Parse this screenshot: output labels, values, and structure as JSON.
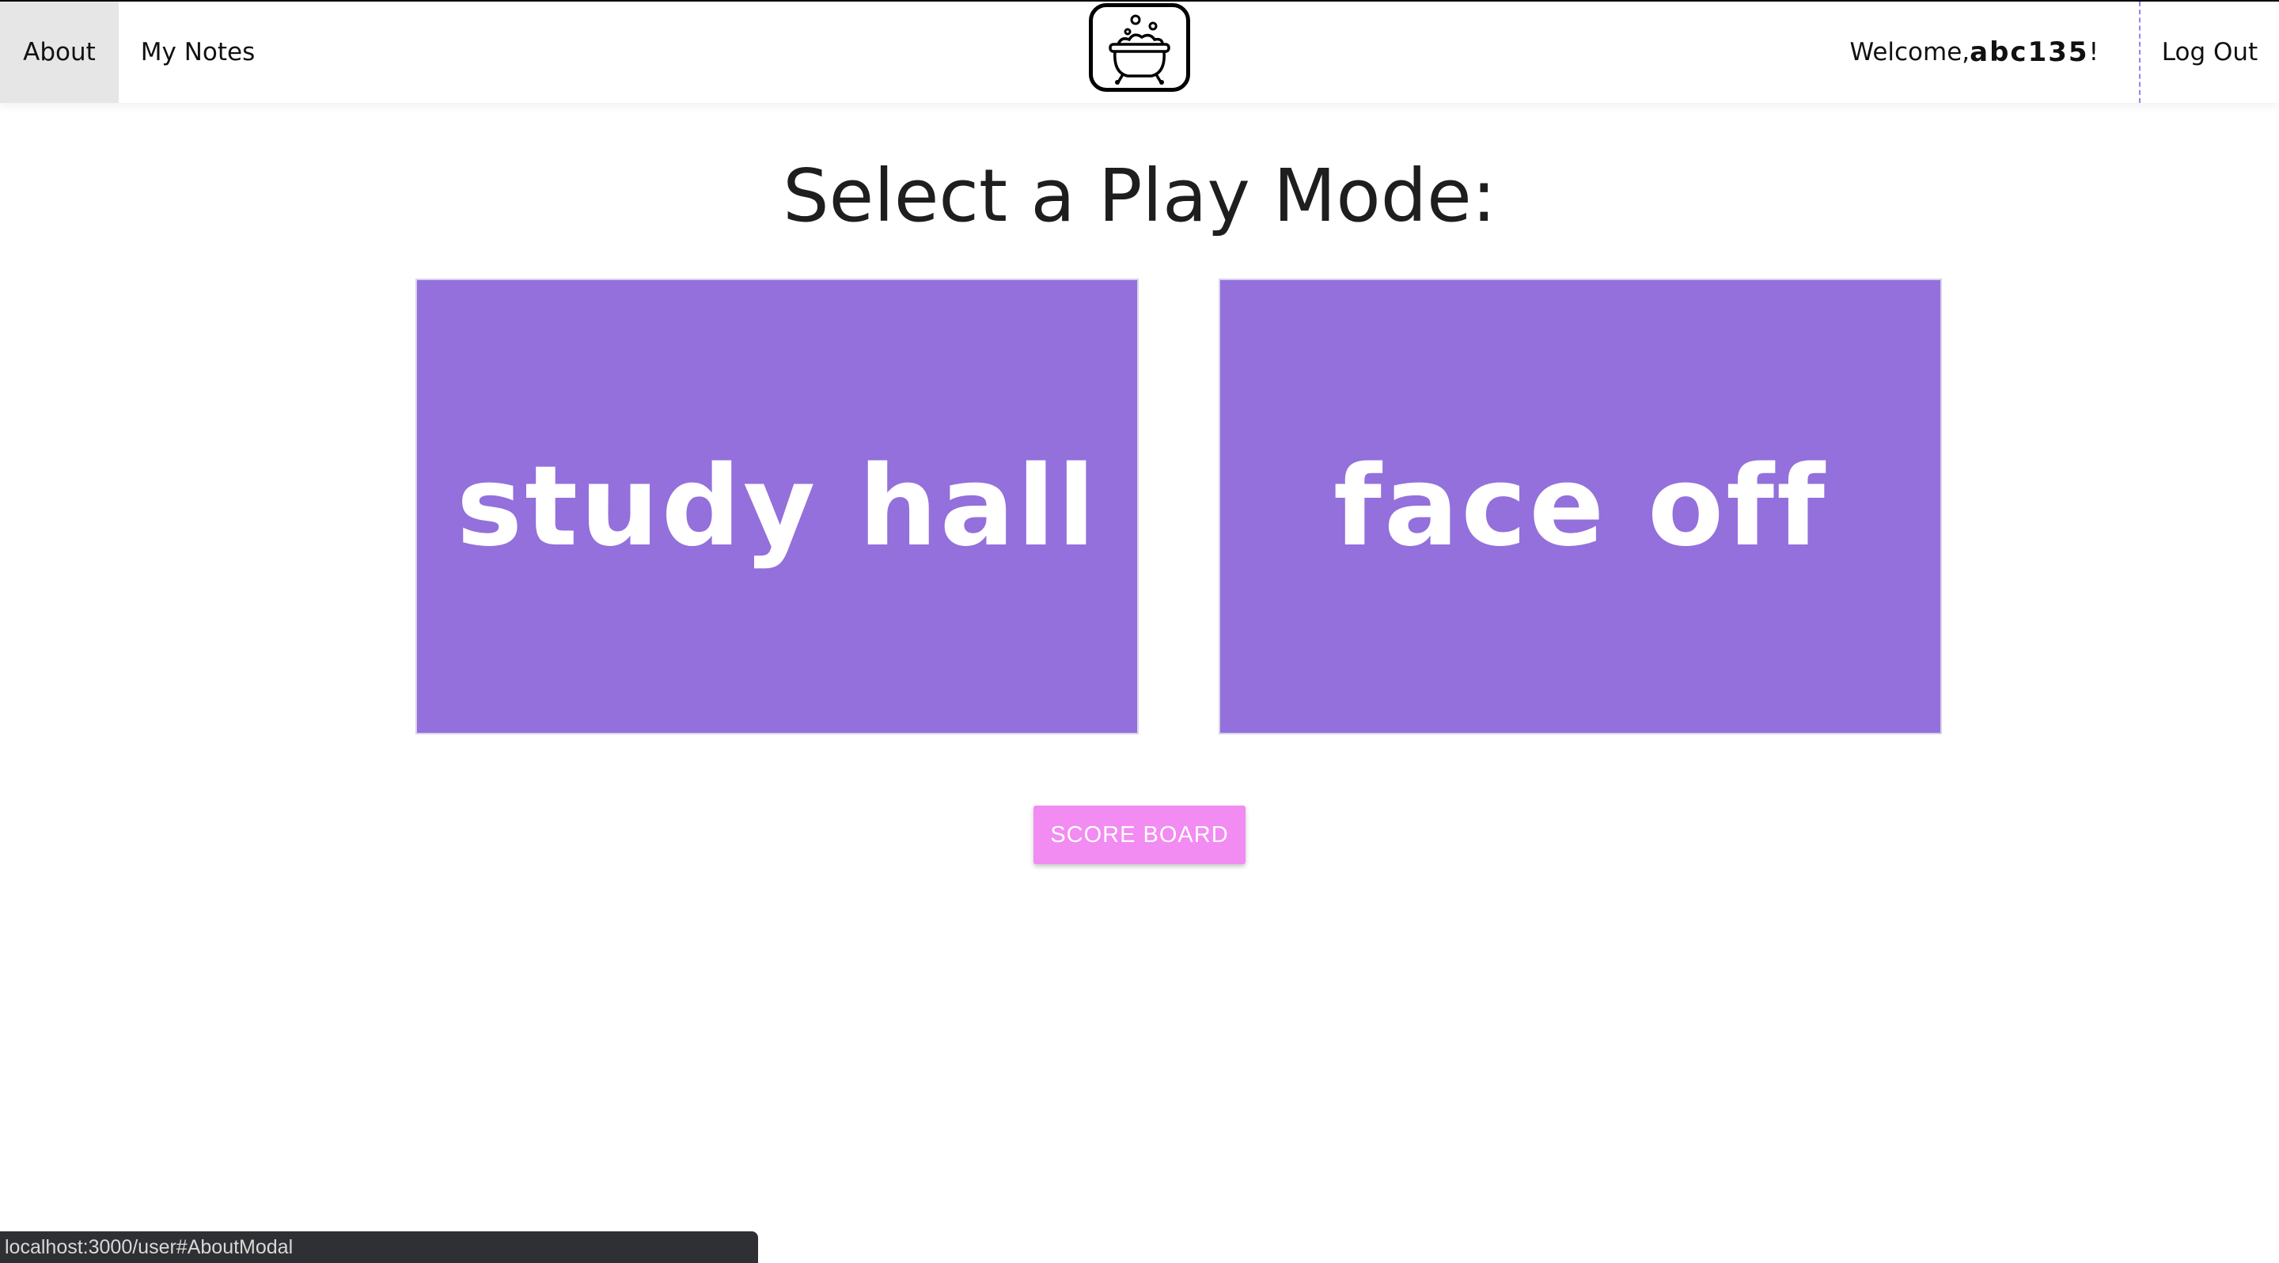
{
  "nav": {
    "about_label": "About",
    "notes_label": "My Notes",
    "logo_icon": "cauldron-icon",
    "welcome_prefix": "Welcome, ",
    "username": "abc135",
    "welcome_suffix": "!",
    "logout_label": "Log Out"
  },
  "main": {
    "title": "Select a Play Mode:",
    "modes": [
      {
        "label": "study hall"
      },
      {
        "label": "face off"
      }
    ],
    "scoreboard_label": "SCORE BOARD"
  },
  "status": {
    "url": "localhost:3000/user#AboutModal"
  },
  "colors": {
    "mode_card": "#9370db",
    "scoreboard": "#f28bf2",
    "about_bg": "#e6e6e6",
    "divider": "#9b7ff0"
  }
}
